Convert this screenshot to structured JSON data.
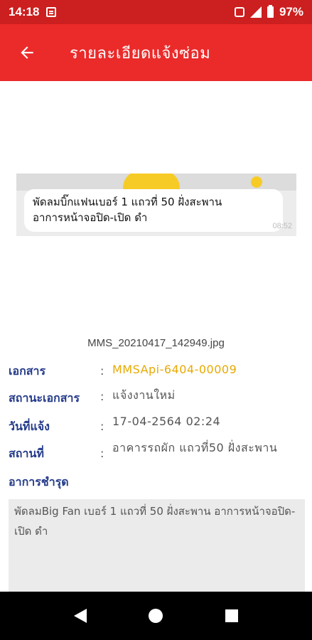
{
  "status_bar": {
    "time": "14:18",
    "battery": "97%"
  },
  "header": {
    "title": "รายละเอียดแจ้งซ่อม"
  },
  "photo": {
    "caption_line1": "พัดลมบิ๊กแฟนเบอร์ 1 แถวที่ 50 ฝั่งสะพาน",
    "caption_line2": "อาการหน้าจอปิด-เปิด ดำ",
    "timestamp": "08:52",
    "filename": "MMS_20210417_142949.jpg"
  },
  "details": {
    "document_label": "เอกสาร",
    "document_value": "MMSApi-6404-00009",
    "status_label": "สถานะเอกสาร",
    "status_value": "แจ้งงานใหม่",
    "date_label": "วันที่แจ้ง",
    "date_value": "17-04-2564 02:24",
    "location_label": "สถานที่",
    "location_value": "อาคารรถผัก แถวที่50 ฝั่งสะพาน",
    "symptom_label": "อาการชำรุด",
    "symptom_value": "พัดลมBig Fan เบอร์ 1 แถวที่ 50 ฝั่งสะพาน  อาการหน้าจอปิด-เปิด ดำ",
    "colon": ":"
  },
  "colors": {
    "header": "#eb2a2a",
    "status_bar": "#cc1f1f",
    "label": "#243b8a",
    "document_value": "#e8a900"
  },
  "icons": [
    "back-arrow-icon",
    "message-icon",
    "vibrate-icon",
    "signal-icon",
    "battery-icon",
    "nav-back-icon",
    "nav-home-icon",
    "nav-recent-icon"
  ]
}
